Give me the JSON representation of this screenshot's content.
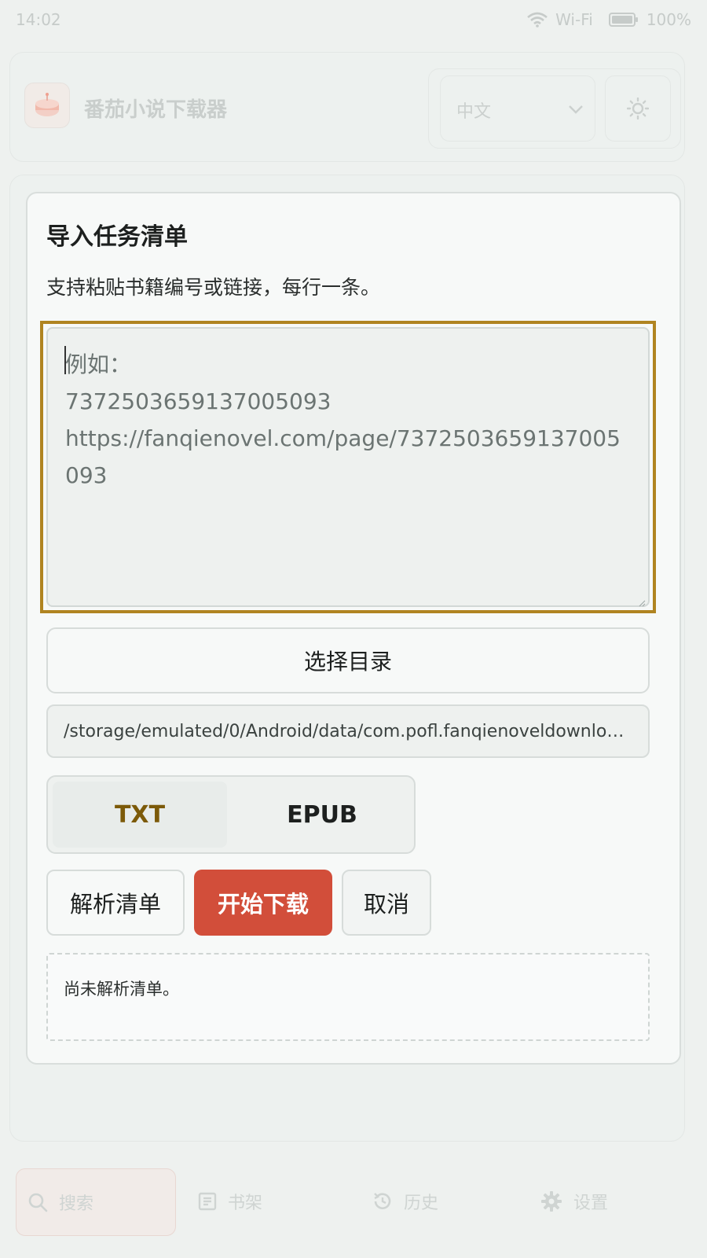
{
  "status_bar": {
    "time": "14:02",
    "wifi_label": "Wi-Fi",
    "battery": "100%"
  },
  "header": {
    "app_title": "番茄小说下载器",
    "language": "中文",
    "logo_icon": "tomato-cake-icon",
    "theme_icon": "sun-icon"
  },
  "dialog": {
    "title": "导入任务清单",
    "description": "支持粘贴书籍编号或链接，每行一条。",
    "textarea": {
      "value": "",
      "placeholder": "例如：\n7372503659137005093\nhttps://fanqienovel.com/page/7372503659137005093"
    },
    "choose_dir_label": "选择目录",
    "save_path": "/storage/emulated/0/Android/data/com.pofl.fanqienoveldownloader/files/downloads",
    "formats": [
      "TXT",
      "EPUB"
    ],
    "selected_format": "TXT",
    "buttons": {
      "parse": "解析清单",
      "start": "开始下载",
      "cancel": "取消"
    },
    "status_text": "尚未解析清单。"
  },
  "bottom_nav": [
    {
      "label": "搜索",
      "icon": "search-icon",
      "active": true
    },
    {
      "label": "书架",
      "icon": "bookshelf-icon",
      "active": false
    },
    {
      "label": "历史",
      "icon": "history-icon",
      "active": false
    },
    {
      "label": "设置",
      "icon": "gear-icon",
      "active": false
    }
  ],
  "colors": {
    "accent": "#d24e3a",
    "focus_ring": "#b08421",
    "selected_format_text": "#7c5a09"
  }
}
